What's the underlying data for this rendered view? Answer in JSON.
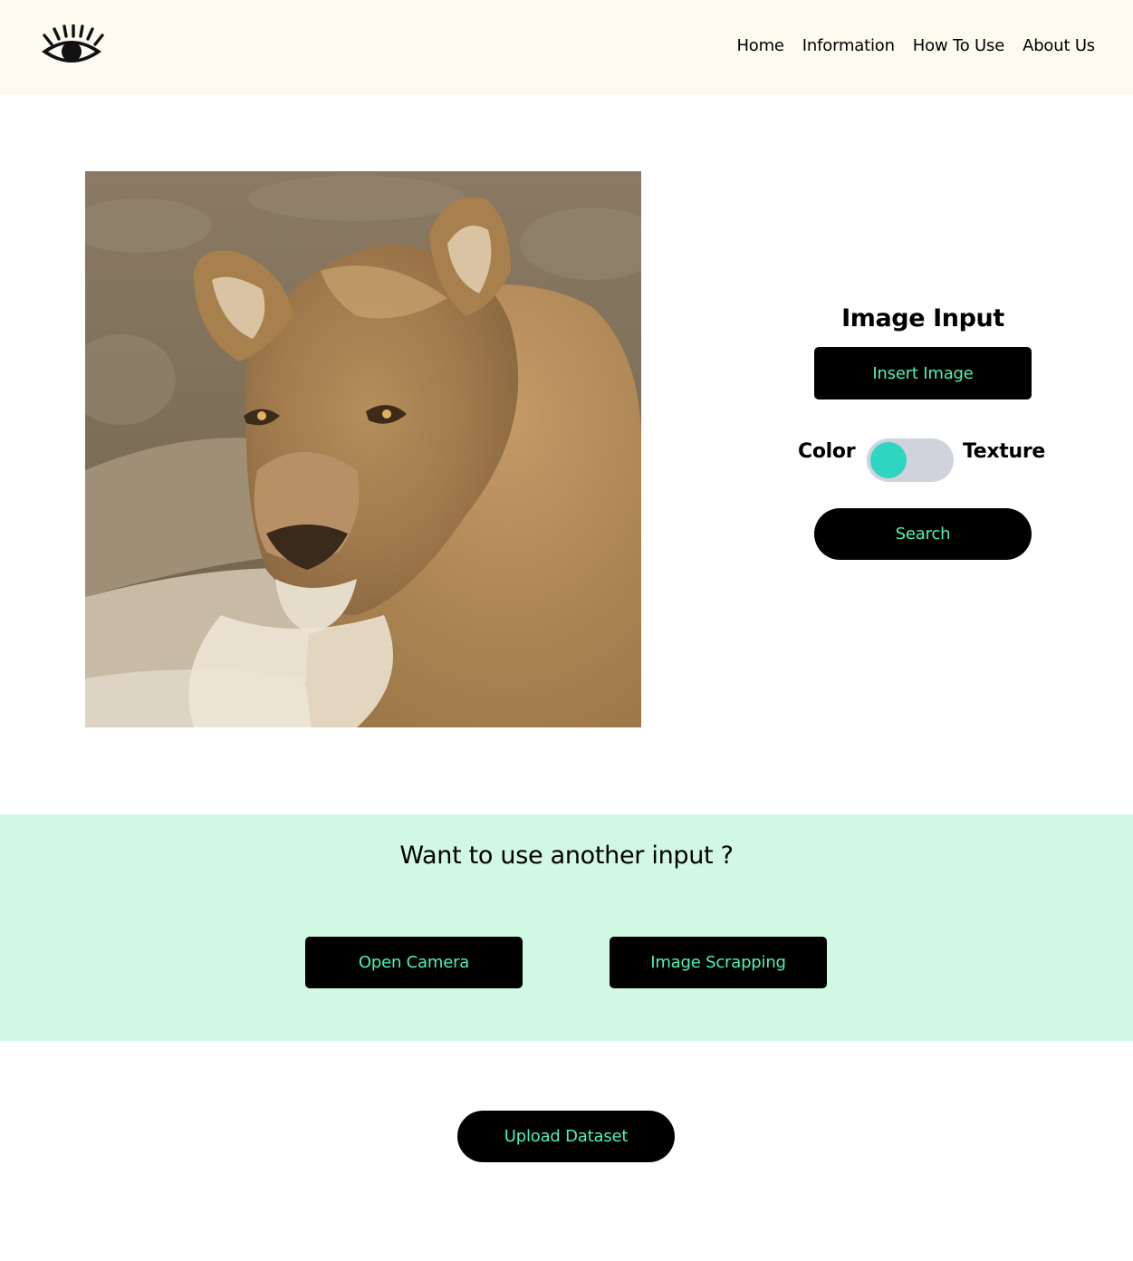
{
  "nav": {
    "logo_icon": "eye-icon",
    "links": [
      "Home",
      "Information",
      "How To Use",
      "About Us"
    ]
  },
  "preview": {
    "icon": "lioness-photo"
  },
  "image_input": {
    "title": "Image Input",
    "insert_label": "Insert Image",
    "toggle": {
      "left_label": "Color",
      "right_label": "Texture",
      "selected": "Color"
    },
    "search_label": "Search"
  },
  "alternative": {
    "title": "Want to use another input ?",
    "camera_label": "Open Camera",
    "scrapping_label": "Image Scrapping"
  },
  "upload_label": "Upload Dataset",
  "colors": {
    "accent": "#4ff3b3",
    "navbar_bg": "#fdfaf0",
    "alt_section_bg": "#d0f8e2",
    "toggle_knob": "#2ed5c0",
    "toggle_track": "#d1d3dc"
  }
}
